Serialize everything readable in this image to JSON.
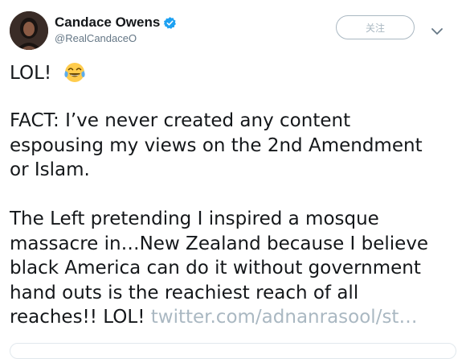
{
  "author": {
    "display_name": "Candace Owens",
    "handle": "@RealCandaceO",
    "verified": true
  },
  "follow_button": {
    "label": "关注"
  },
  "tweet": {
    "line1": "LOL!",
    "emoji": "face-with-tears-of-joy",
    "fact_lines": [
      "FACT: I’ve never created any content",
      "espousing my views on the 2nd Amendment",
      "or Islam."
    ],
    "left_lines": [
      "The Left pretending I inspired a mosque",
      "massacre in…New Zealand because I believe",
      "black America can do it without government",
      "hand outs is the reachiest reach of all"
    ],
    "last_line_text": "reaches!! LOL!",
    "link_text": "twitter.com/adnanrasool/st…"
  },
  "colors": {
    "text": "#14171a",
    "secondary": "#657786",
    "verified": "#1da1f2",
    "link": "#aab8c2",
    "border": "#e1e8ed"
  }
}
